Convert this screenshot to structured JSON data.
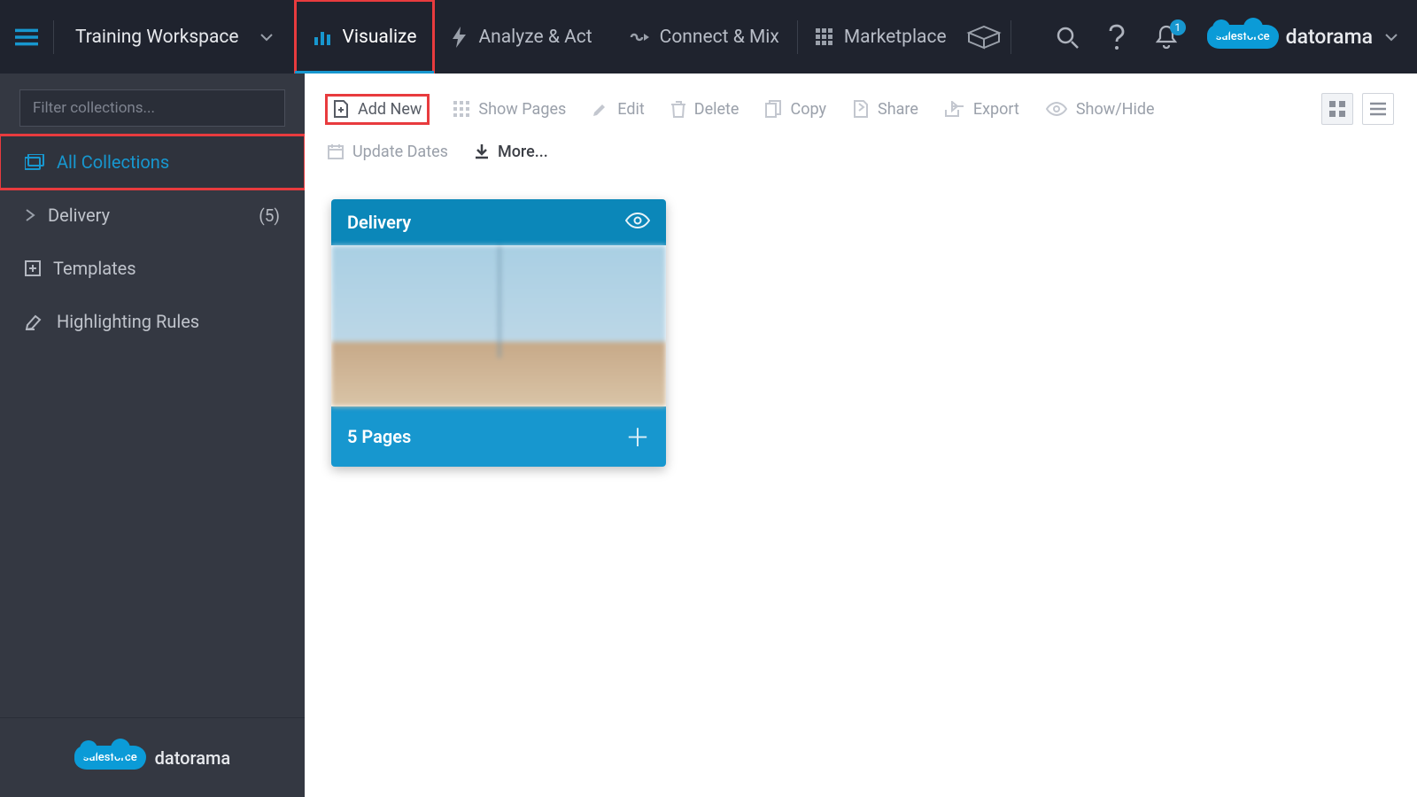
{
  "header": {
    "workspace": "Training Workspace",
    "nav": {
      "visualize": "Visualize",
      "analyze": "Analyze & Act",
      "connect": "Connect & Mix",
      "marketplace": "Marketplace"
    },
    "notification_count": "1",
    "brand": "datorama",
    "sf": "salesforce"
  },
  "sidebar": {
    "filter_placeholder": "Filter collections...",
    "all_collections": "All Collections",
    "delivery": {
      "label": "Delivery",
      "count": "(5)"
    },
    "templates": "Templates",
    "highlighting": "Highlighting Rules",
    "footer_brand": "datorama",
    "footer_sf": "salesforce"
  },
  "toolbar": {
    "add_new": "Add New",
    "show_pages": "Show Pages",
    "edit": "Edit",
    "delete": "Delete",
    "copy": "Copy",
    "share": "Share",
    "export": "Export",
    "show_hide": "Show/Hide",
    "update_dates": "Update Dates",
    "more": "More..."
  },
  "card": {
    "title": "Delivery",
    "footer": "5 Pages"
  }
}
